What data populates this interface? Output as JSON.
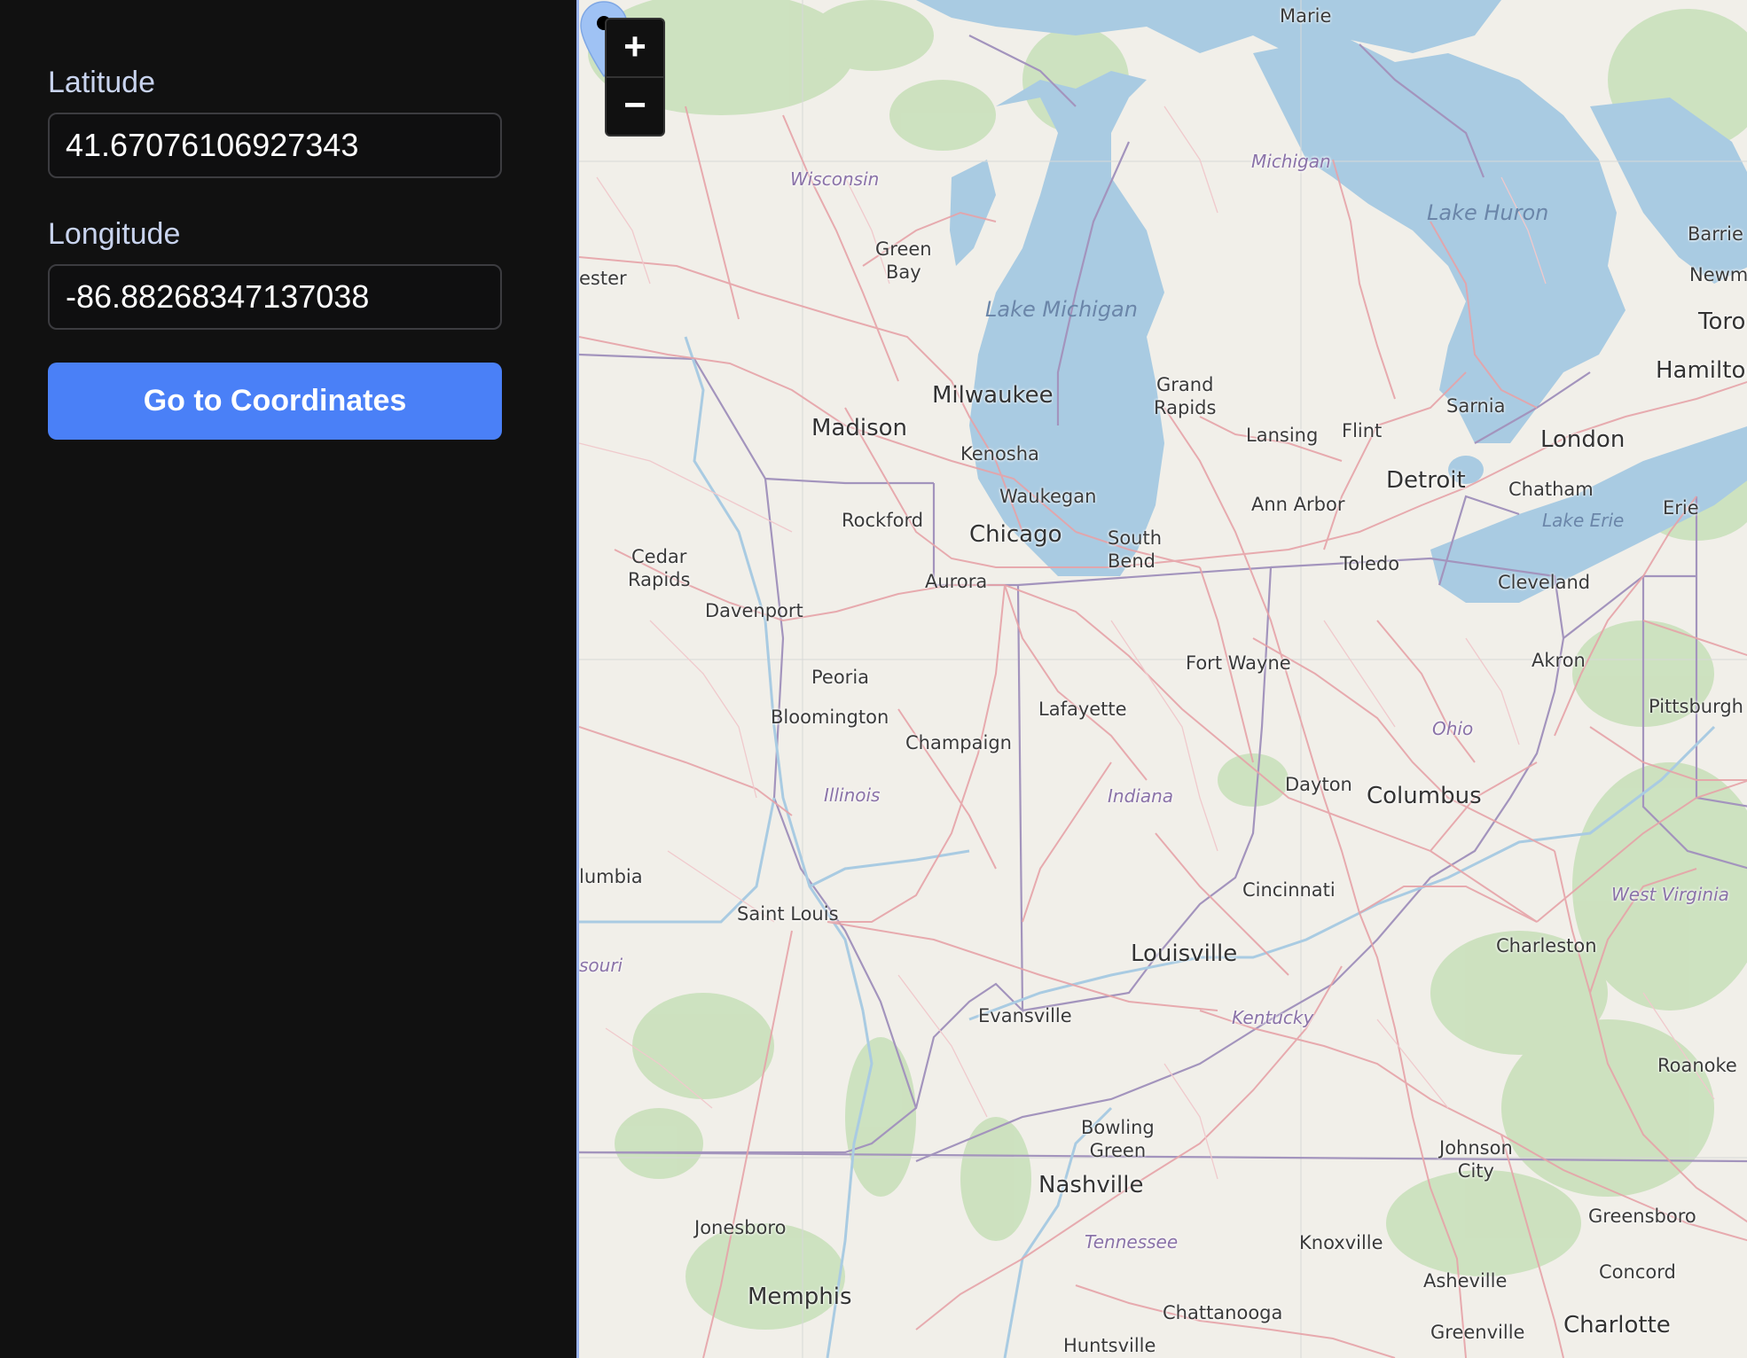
{
  "form": {
    "latitude_label": "Latitude",
    "latitude_value": "41.67076106927343",
    "longitude_label": "Longitude",
    "longitude_value": "-86.88268347137038",
    "submit_label": "Go to Coordinates"
  },
  "map": {
    "zoom_in_label": "+",
    "zoom_out_label": "−",
    "colors": {
      "land": "#f1efe9",
      "water": "#a9cbe2",
      "road": "#e6a3a8",
      "forest": "#c7dfb8",
      "border": "#8f7da8",
      "marker": "#9fc2f4",
      "accent": "#4a80f7"
    },
    "labels": {
      "sault_marie": "Marie",
      "wisconsin": "Wisconsin",
      "michigan": "Michigan",
      "lake_huron": "Lake Huron",
      "barrie": "Barrie",
      "newmarket": "Newm",
      "toronto": "Toro",
      "hamilton": "Hamilton",
      "rochester": "ester",
      "green_bay": "Green\nBay",
      "lake_michigan": "Lake Michigan",
      "grand_rapids": "Grand\nRapids",
      "milwaukee": "Milwaukee",
      "madison": "Madison",
      "lansing": "Lansing",
      "flint": "Flint",
      "sarnia": "Sarnia",
      "london": "London",
      "kenosha": "Kenosha",
      "detroit": "Detroit",
      "chatham": "Chatham",
      "waukegan": "Waukegan",
      "ann_arbor": "Ann Arbor",
      "lake_erie": "Lake Erie",
      "erie": "Erie",
      "rockford": "Rockford",
      "chicago": "Chicago",
      "south_bend": "South\nBend",
      "cedar_rapids": "Cedar\nRapids",
      "toledo": "Toledo",
      "cleveland": "Cleveland",
      "aurora": "Aurora",
      "davenport": "Davenport",
      "fort_wayne": "Fort Wayne",
      "akron": "Akron",
      "peoria": "Peoria",
      "pittsburgh": "Pittsburgh",
      "lafayette": "Lafayette",
      "bloomington": "Bloomington",
      "ohio": "Ohio",
      "champaign": "Champaign",
      "dayton": "Dayton",
      "columbus": "Columbus",
      "illinois": "Illinois",
      "indiana": "Indiana",
      "columbia": "lumbia",
      "cincinnati": "Cincinnati",
      "west_virginia": "West Virginia",
      "saint_louis": "Saint Louis",
      "charleston": "Charleston",
      "louisville": "Louisville",
      "missouri": "souri",
      "evansville": "Evansville",
      "kentucky": "Kentucky",
      "roanoke": "Roanoke",
      "bowling_green": "Bowling\nGreen",
      "johnson_city": "Johnson\nCity",
      "nashville": "Nashville",
      "greensboro": "Greensboro",
      "jonesboro": "Jonesboro",
      "tennessee": "Tennessee",
      "knoxville": "Knoxville",
      "concord": "Concord",
      "asheville": "Asheville",
      "memphis": "Memphis",
      "chattanooga": "Chattanooga",
      "charlotte": "Charlotte",
      "greenville": "Greenville",
      "huntsville": "Huntsville"
    }
  }
}
